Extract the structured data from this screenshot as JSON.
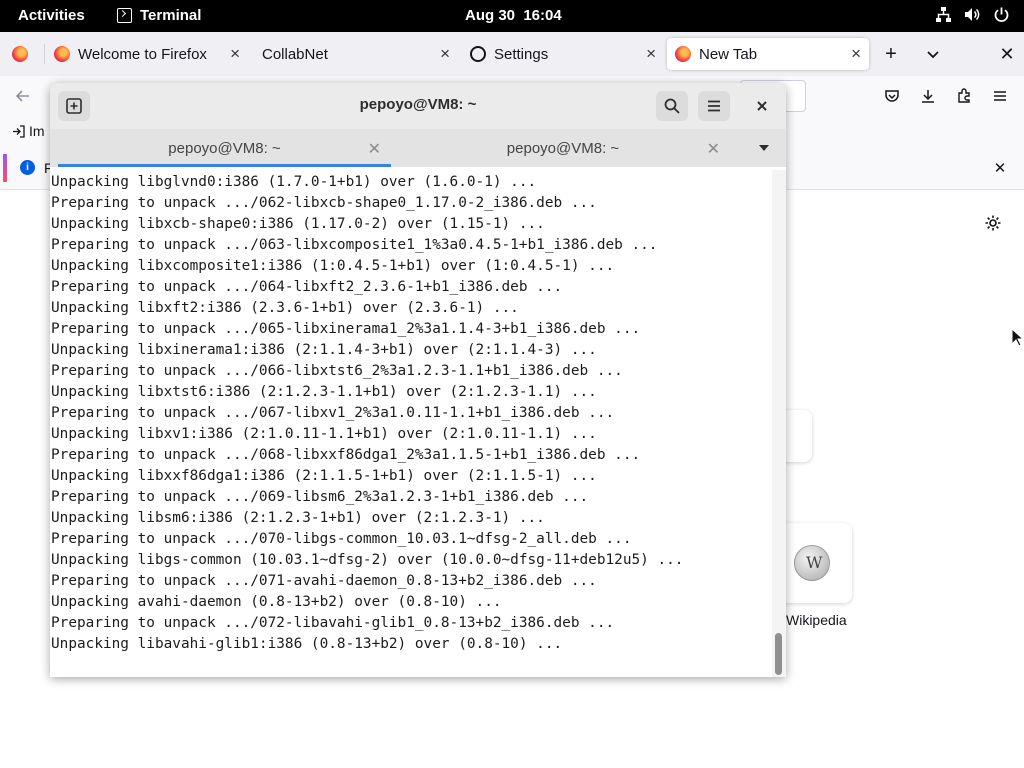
{
  "topbar": {
    "activities": "Activities",
    "app_name": "Terminal",
    "clock": "Aug 30  16:04",
    "status_icons": [
      "network-icon",
      "volume-icon",
      "power-icon"
    ]
  },
  "firefox": {
    "tabs": [
      {
        "label": "Welcome to Firefox",
        "icon": "firefox-icon"
      },
      {
        "label": "CollabNet",
        "icon": ""
      },
      {
        "label": "Settings",
        "icon": "gear-icon"
      },
      {
        "label": "New Tab",
        "icon": "firefox-icon",
        "active": true
      }
    ],
    "bookmark_label": "Im",
    "infobar_letter": "F",
    "wikipedia_label": "Wikipedia"
  },
  "terminal": {
    "title": "pepoyo@VM8: ~",
    "tabs": [
      {
        "label": "pepoyo@VM8: ~",
        "active": true
      },
      {
        "label": "pepoyo@VM8: ~",
        "active": false
      }
    ],
    "lines": [
      "Unpacking libglvnd0:i386 (1.7.0-1+b1) over (1.6.0-1) ...",
      "Preparing to unpack .../062-libxcb-shape0_1.17.0-2_i386.deb ...",
      "Unpacking libxcb-shape0:i386 (1.17.0-2) over (1.15-1) ...",
      "Preparing to unpack .../063-libxcomposite1_1%3a0.4.5-1+b1_i386.deb ...",
      "Unpacking libxcomposite1:i386 (1:0.4.5-1+b1) over (1:0.4.5-1) ...",
      "Preparing to unpack .../064-libxft2_2.3.6-1+b1_i386.deb ...",
      "Unpacking libxft2:i386 (2.3.6-1+b1) over (2.3.6-1) ...",
      "Preparing to unpack .../065-libxinerama1_2%3a1.1.4-3+b1_i386.deb ...",
      "Unpacking libxinerama1:i386 (2:1.1.4-3+b1) over (2:1.1.4-3) ...",
      "Preparing to unpack .../066-libxtst6_2%3a1.2.3-1.1+b1_i386.deb ...",
      "Unpacking libxtst6:i386 (2:1.2.3-1.1+b1) over (2:1.2.3-1.1) ...",
      "Preparing to unpack .../067-libxv1_2%3a1.0.11-1.1+b1_i386.deb ...",
      "Unpacking libxv1:i386 (2:1.0.11-1.1+b1) over (2:1.0.11-1.1) ...",
      "Preparing to unpack .../068-libxxf86dga1_2%3a1.1.5-1+b1_i386.deb ...",
      "Unpacking libxxf86dga1:i386 (2:1.1.5-1+b1) over (2:1.1.5-1) ...",
      "Preparing to unpack .../069-libsm6_2%3a1.2.3-1+b1_i386.deb ...",
      "Unpacking libsm6:i386 (2:1.2.3-1+b1) over (2:1.2.3-1) ...",
      "Preparing to unpack .../070-libgs-common_10.03.1~dfsg-2_all.deb ...",
      "Unpacking libgs-common (10.03.1~dfsg-2) over (10.0.0~dfsg-11+deb12u5) ...",
      "Preparing to unpack .../071-avahi-daemon_0.8-13+b2_i386.deb ...",
      "Unpacking avahi-daemon (0.8-13+b2) over (0.8-10) ...",
      "Preparing to unpack .../072-libavahi-glib1_0.8-13+b2_i386.deb ...",
      "Unpacking libavahi-glib1:i386 (0.8-13+b2) over (0.8-10) ..."
    ]
  },
  "colors": {
    "accent": "#3584e4",
    "topbar": "#000000",
    "terminal_header": "#ebebeb"
  }
}
